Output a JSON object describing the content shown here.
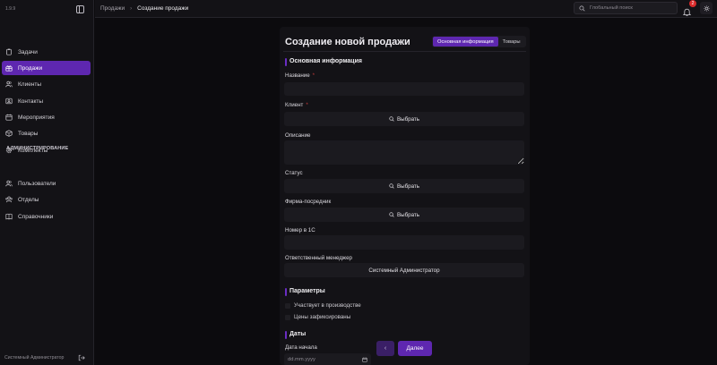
{
  "app": {
    "version": "1.9.9"
  },
  "sidebar": {
    "items": [
      {
        "label": "Задачи",
        "icon": "clipboard-icon"
      },
      {
        "label": "Продажи",
        "icon": "gift-icon",
        "active": true
      },
      {
        "label": "Клиенты",
        "icon": "users-icon"
      },
      {
        "label": "Контакты",
        "icon": "contact-card-icon"
      },
      {
        "label": "Мероприятия",
        "icon": "calendar-icon"
      },
      {
        "label": "Товары",
        "icon": "box-icon"
      },
      {
        "label": "Комплекты",
        "icon": "gear-icon"
      }
    ],
    "admin_label": "АДМИНИСТРИРОВАНИЕ",
    "admin_items": [
      {
        "label": "Пользователи",
        "icon": "users-icon"
      },
      {
        "label": "Отделы",
        "icon": "users-group-icon"
      },
      {
        "label": "Справочники",
        "icon": "book-icon"
      }
    ],
    "footer_user": "Системный Администратор"
  },
  "topbar": {
    "breadcrumb": [
      "Продажи",
      "Создание продажи"
    ],
    "search_placeholder": "Глобальный поиск",
    "notifications_count": "2"
  },
  "form": {
    "title": "Создание новой продажи",
    "tabs": [
      {
        "label": "Основная информация",
        "active": true
      },
      {
        "label": "Товары",
        "active": false
      }
    ],
    "section_main": "Основная информация",
    "fields": {
      "name": {
        "label": "Название",
        "required": "*",
        "value": ""
      },
      "client": {
        "label": "Клиент",
        "required": "*",
        "button": "Выбрать"
      },
      "description": {
        "label": "Описание",
        "value": ""
      },
      "status": {
        "label": "Статус",
        "button": "Выбрать"
      },
      "intermediary": {
        "label": "Фирма-посредник",
        "button": "Выбрать"
      },
      "number_1c": {
        "label": "Номер в 1С",
        "value": ""
      },
      "manager": {
        "label": "Ответственный менеджер",
        "value": "Системный Администратор"
      }
    },
    "section_params": "Параметры",
    "params": [
      {
        "label": "Участвует в производстве",
        "checked": false
      },
      {
        "label": "Цены зафиксированы",
        "checked": false
      }
    ],
    "section_dates": "Даты",
    "start_date": {
      "label": "Дата начала",
      "placeholder": "dd.mm.yyyy"
    }
  },
  "wizard": {
    "back": "‹",
    "next": "Далее"
  },
  "colors": {
    "accent": "#5e27b0",
    "background": "#0c0b0e",
    "panel": "#131216",
    "danger": "#d92b2b"
  }
}
